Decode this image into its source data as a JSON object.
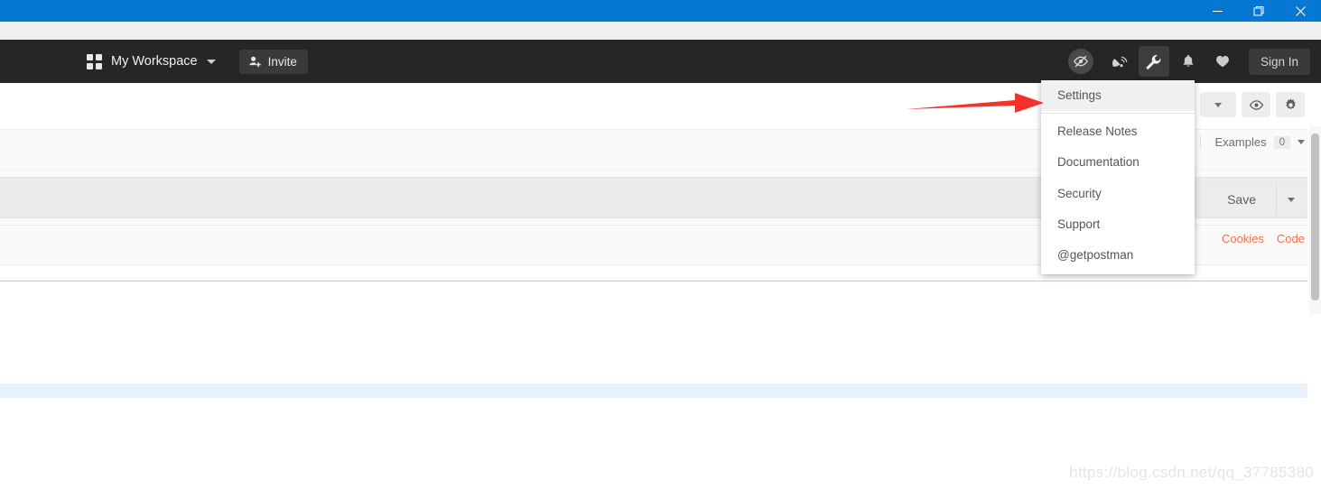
{
  "window": {
    "controls": [
      {
        "name": "minimize",
        "glyph": "minimize-icon"
      },
      {
        "name": "restore",
        "glyph": "restore-icon"
      },
      {
        "name": "close",
        "glyph": "close-icon"
      }
    ],
    "titlebar_color": "#0677d3"
  },
  "navbar": {
    "background": "#262626",
    "workspace_label": "My Workspace",
    "invite_label": "Invite",
    "signin_label": "Sign In",
    "icons": [
      {
        "name": "eye-slash-avatar-icon",
        "active": false
      },
      {
        "name": "satellite-dish-icon",
        "active": false
      },
      {
        "name": "wrench-icon",
        "active": true
      },
      {
        "name": "bell-icon",
        "active": false
      },
      {
        "name": "heart-icon",
        "active": false
      }
    ]
  },
  "dropdown": {
    "items": [
      {
        "label": "Settings",
        "highlighted": true
      },
      {
        "label": "Release Notes",
        "highlighted": false
      },
      {
        "label": "Documentation",
        "highlighted": false
      },
      {
        "label": "Security",
        "highlighted": false
      },
      {
        "label": "Support",
        "highlighted": false
      },
      {
        "label": "@getpostman",
        "highlighted": false
      }
    ]
  },
  "toolbar": {
    "eye_icon": "eye-icon",
    "gear_icon": "gear-icon",
    "examples_label": "Examples",
    "examples_count": "0",
    "save_label": "Save",
    "cookies_label": "Cookies",
    "code_label": "Code",
    "accent_blue": "#1f8ceb",
    "link_orange": "#f2714a"
  },
  "annotation": {
    "arrow_color": "#f4322c",
    "points_at": "Settings"
  },
  "watermark": {
    "text": "https://blog.csdn.net/qq_37785380"
  }
}
